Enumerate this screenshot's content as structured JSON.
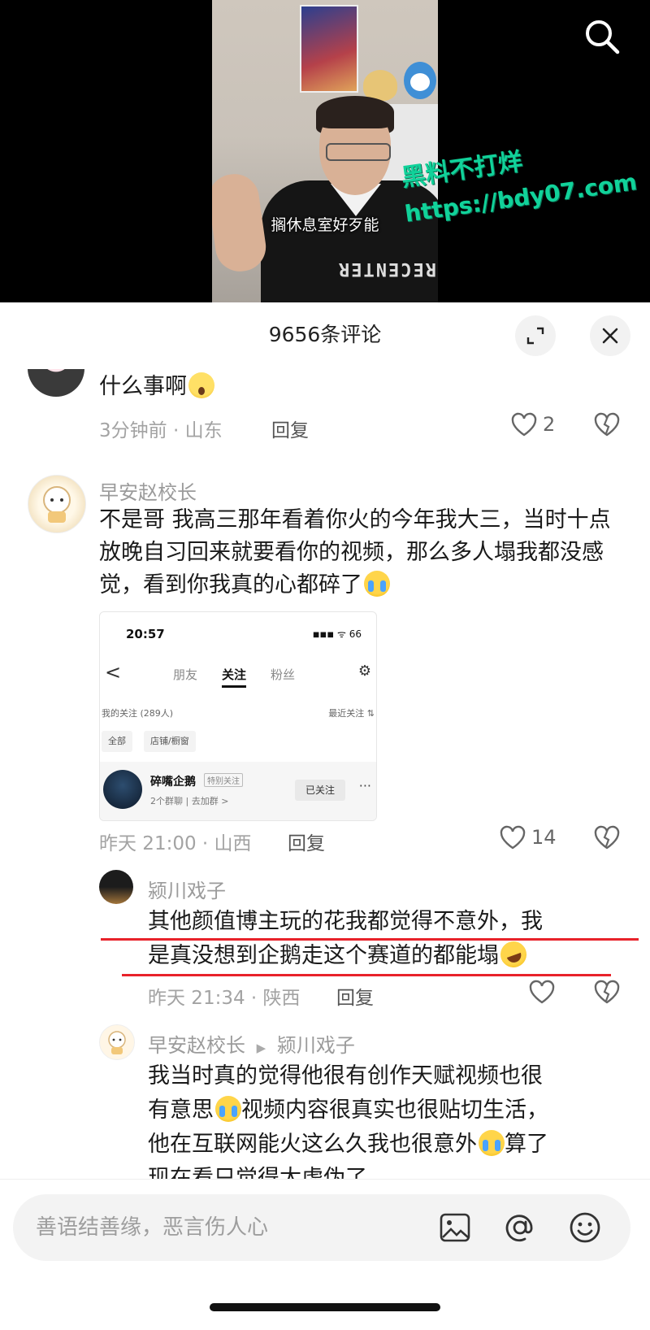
{
  "video": {
    "subtitle": "搁休息室好歹能",
    "watermark_line1": "黑料不打烊",
    "watermark_line2": "https://bdy07.com",
    "shirt_text": "RECENTER"
  },
  "comments_sheet": {
    "title": "9656条评论"
  },
  "comments": [
    {
      "text": "什么事啊",
      "time_location": "3分钟前 · 山东",
      "reply_label": "回复",
      "likes": "2"
    },
    {
      "username": "早安赵校长",
      "text": "不是哥 我高三那年看着你火的今年我大三，当时十点放晚自习回来就要看你的视频，那么多人塌我都没感觉，看到你我真的心都碎了",
      "time_location": "昨天 21:00 · 山西",
      "reply_label": "回复",
      "likes": "14"
    }
  ],
  "embedded_screenshot": {
    "time": "20:57",
    "status": "◾◾◾ ᯤ 66",
    "back": "<",
    "tabs": [
      "朋友",
      "关注",
      "粉丝"
    ],
    "following_count": "我的关注 (289人)",
    "sort_label": "最近关注 ⇅",
    "chips": [
      "全部",
      "店铺/橱窗"
    ],
    "user_name": "碎嘴企鹅",
    "user_tag": "特别关注",
    "user_groups": "2个群聊 | 去加群 >",
    "followed_button": "已关注",
    "more": "···"
  },
  "replies": [
    {
      "username": "颍川戏子",
      "text_line1": "其他颜值博主玩的花我都觉得不意外，我",
      "text_line2": "是真没想到企鹅走这个赛道的都能塌",
      "time_location": "昨天 21:34 · 陕西",
      "reply_label": "回复"
    },
    {
      "username": "早安赵校长",
      "reply_to": "颍川戏子",
      "text_line1": "我当时真的觉得他很有创作天赋视频也很",
      "text_line2": "有意思",
      "text_line2b": "视频内容很真实也很贴切生活，",
      "text_line3": "他在互联网能火这么久我也很意外",
      "text_line3b": "算了",
      "text_line4": "现在看只觉得太虚伪了"
    }
  ],
  "input": {
    "placeholder": "善语结善缘，恶言伤人心"
  },
  "colors": {
    "underline_red": "#e8222a",
    "watermark_green": "#11d29a"
  },
  "icons": [
    "search-icon",
    "expand-icon",
    "close-icon",
    "heart-icon",
    "broken-heart-icon",
    "image-icon",
    "at-icon",
    "emoji-icon"
  ]
}
